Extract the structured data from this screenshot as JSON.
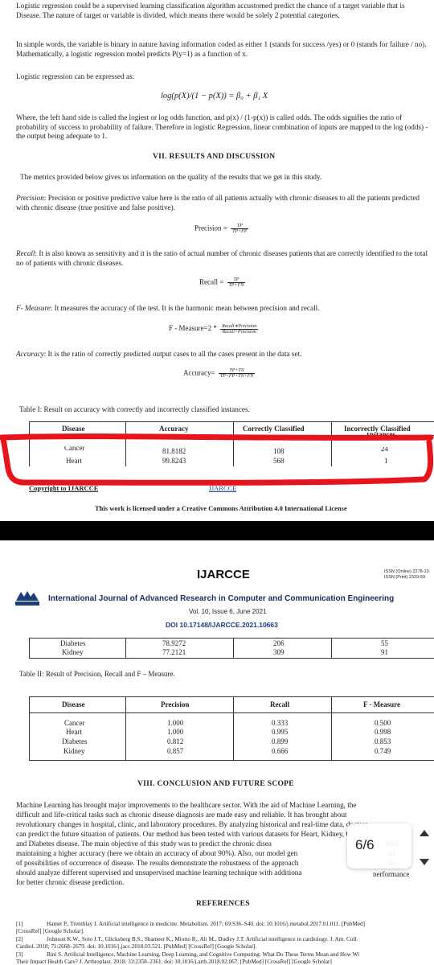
{
  "page1": {
    "intro_paragraph": "Logistic regression could be a supervised learning classification algorithm accustomed predict the chance of a target variable that is Disease. The nature of target or variable is divided, which means there would be solely 2 potential categories.",
    "simple_paragraph": "In simple words, the variable is binary in nature having information coded as either 1 (stands for success /yes) or 0 (stands for failure / no). Mathematically, a logistic regression model predicts P(y=1) as a function of x.",
    "expressed_as": "Logistic regression can be expressed as:",
    "log_equation": "log(p(X)/(1 − p(X)) = β₀ + β₁ X",
    "where_paragraph": "Where, the left hand side is called the logiest or log odds function, and p(x) / (1-p(x)) is called odds. The odds signifies the ratio of probability of success to probability of failure. Therefore in logistic Regression, linear combination of inputs are mapped to the log (odds) - the output being adequate to 1.",
    "section_title": "VII.      RESULTS AND DISCUSSION",
    "metrics_intro": "The metrics provided below gives us information on the quality of the results that we get in this study.",
    "precision_term": "Precision",
    "precision_def": ": Precision or positive predictive value here is the ratio of all patients actually with chronic diseases to all the patients predicted with chronic disease (true positive and false positive).",
    "precision_formula": {
      "label": "Precision =",
      "num": "TP",
      "den": "TP+FP"
    },
    "recall_term": "Recall",
    "recall_def": ": It is also known as sensitivity and it is the ratio of actual number of chronic diseases patients that are correctly identified to the total no of patients with chronic diseases.",
    "recall_formula": {
      "label": "Recall =",
      "num": "TP",
      "den": "TP+FN"
    },
    "fmeasure_term": "F- Measure",
    "fmeasure_def": ": It measures the accuracy of the test. It is the harmonic mean between precision and recall.",
    "fmeasure_formula": {
      "label": "F - Measure=2 *",
      "num": "Recall∗Precision",
      "den": "Recall+Precision"
    },
    "accuracy_term": "Accuracy",
    "accuracy_def": ": It is the ratio of correctly predicted output cases to all the cases present in the data set.",
    "accuracy_formula": {
      "label": "Accuracy=",
      "num": "TP+TN",
      "den": "TP+FP+TN+FN"
    },
    "table1_caption": "Table I: Result on accuracy with correctly and incorrectly classified instances.",
    "table1_headers": [
      "Disease",
      "Accuracy",
      "Correctly Classified",
      "Incorrectly Classified"
    ],
    "table1_header_cut": "Instances",
    "table1_rows": [
      [
        "Cancer",
        "81.8182",
        "108",
        "24"
      ],
      [
        "Heart",
        "99.8243",
        "568",
        "1"
      ]
    ],
    "footer_copyright": "Copyright to IJARCCE",
    "footer_journal": "IJARCCE",
    "footer_license": "This work is licensed under a Creative Commons Attribution 4.0 International License"
  },
  "page2": {
    "journal_short": "IJARCCE",
    "issn_online": "ISSN (Online) 2278-10",
    "issn_print": "ISSN (Print) 2319-59",
    "logo_text": "IJARCCE",
    "journal_full": "International Journal of Advanced Research in Computer and Communication Engineering",
    "volume": "Vol. 10, Issue 6, June 2021",
    "doi": "DOI  10.17148/IJARCCE.2021.10663",
    "table1_cont_rows": [
      [
        "Diabetes",
        "78.9272",
        "206",
        "55"
      ],
      [
        "Kidney",
        "77.2121",
        "309",
        "91"
      ]
    ],
    "table2_caption": "Table II:  Result of Precision, Recall and F – Measure.",
    "table2_headers": [
      "Disease",
      "Precision",
      "Recall",
      "F - Measure"
    ],
    "table2_rows": [
      [
        "Cancer",
        "1.000",
        "0.333",
        "0.500"
      ],
      [
        "Heart",
        "1.000",
        "0.995",
        "0.998"
      ],
      [
        "Diabetes",
        "0.812",
        "0.899",
        "0.853"
      ],
      [
        "Kidney",
        "0.857",
        "0.666",
        "0.749"
      ]
    ],
    "section8_title": "VIII.      CONCLUSION AND FUTURE SCOPE",
    "conclusion_lines": [
      "Machine Learning has brought major improvements to the healthcare sector. With the aid of Machine Learning, the",
      "difficult and life-critical tasks such as chronic disease diagnosis are made easy and reliable. It has brought about",
      "revolutionary changes in hospital, clinic, and laboratory procedures. By analyzing historical and real-time data, doctors",
      "can predict the future situation of patients. Our method has been tested with various datasets for Heart, Kidney, C",
      "and Diabetes disease. The main objective of this study was to predict the chronic disea",
      "maintaining a higher accuracy (here we obtain an accuracy of about 90%). Also, our model gen",
      "of possibilities of occurrence of disease. The results demonstrate the robustness of the approach",
      "should analyze different supervised and unsupervised machine learning technique with additiona",
      "for better chronic disease prediction."
    ],
    "conclusion_tail": [
      "tribu",
      "ort",
      "atur",
      "performance"
    ],
    "references_title": "REFERENCES",
    "references": [
      {
        "num": "[1]",
        "l1": "Hamet P., Tremblay J. Artificial intelligence in medicine. Metabolism. 2017; 69:S36–S40. doi: 10.1016/j.metabol.2017.01.011. [PubMed]",
        "l2": "[CrossRef] [Google Scholar]."
      },
      {
        "num": "[2]",
        "l1": "Johnson K.W., Soto J.T., Glicksberg B.S., Shameer K., Miotto R., Ali M., Dudley J.T. Artificial intelligence in cardiology. J. Am. Coll.",
        "l2": "Cardiol. 2018; 71:2668–2679. doi: 10.1016/j.jacc.2018.03.521. [PubMed] [CrossRef] [Google Scholar]."
      },
      {
        "num": "[3]",
        "l1": "Bini S. Artificial Intelligence, Machine Learning, Deep Learning, and Cognitive Computing: What Do These Terms Mean and How Wi",
        "l2": "Their Impact Health Care? J. Arthroplast. 2018; 33:2358–2361. doi: 10.1016/j.arth.2018.02.067. [PubMed] [CrossRef] [Google Scholar]"
      }
    ]
  },
  "page_counter": "6/6",
  "nav": {
    "up_icon": "triangle-up-icon",
    "down_icon": "triangle-down-icon"
  },
  "colors": {
    "annotation_red": "#e8141b",
    "divider_band": "#000000",
    "logo_blue": "#1a3d7c",
    "doi_blue": "#1a3d7c"
  }
}
